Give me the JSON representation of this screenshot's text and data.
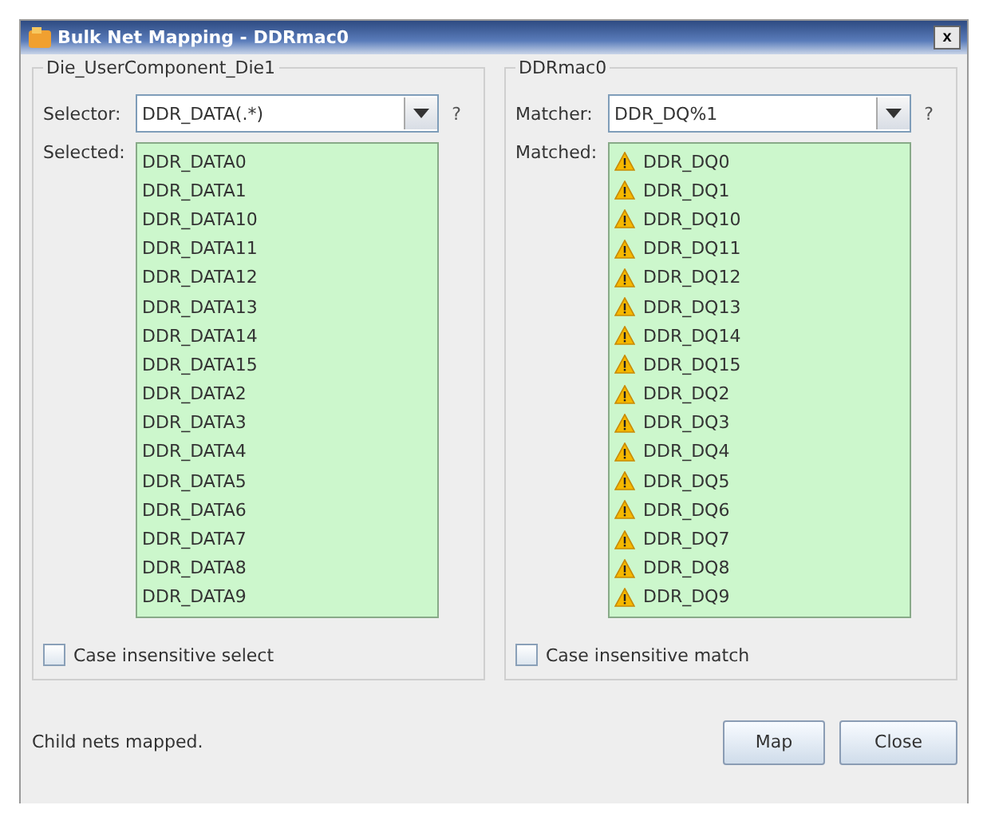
{
  "window": {
    "title": "Bulk Net Mapping - DDRmac0",
    "close": "x"
  },
  "panels": [
    {
      "title": "Die_UserComponent_Die1",
      "field_label": "Selector:",
      "field_value": "DDR_DATA(.*)",
      "help": "?",
      "list_label": "Selected:",
      "items": [
        {
          "label": "DDR_DATA0",
          "warning": false
        },
        {
          "label": "DDR_DATA1",
          "warning": false
        },
        {
          "label": "DDR_DATA10",
          "warning": false
        },
        {
          "label": "DDR_DATA11",
          "warning": false
        },
        {
          "label": "DDR_DATA12",
          "warning": false
        },
        {
          "label": "DDR_DATA13",
          "warning": false
        },
        {
          "label": "DDR_DATA14",
          "warning": false
        },
        {
          "label": "DDR_DATA15",
          "warning": false
        },
        {
          "label": "DDR_DATA2",
          "warning": false
        },
        {
          "label": "DDR_DATA3",
          "warning": false
        },
        {
          "label": "DDR_DATA4",
          "warning": false
        },
        {
          "label": "DDR_DATA5",
          "warning": false
        },
        {
          "label": "DDR_DATA6",
          "warning": false
        },
        {
          "label": "DDR_DATA7",
          "warning": false
        },
        {
          "label": "DDR_DATA8",
          "warning": false
        },
        {
          "label": "DDR_DATA9",
          "warning": false
        }
      ],
      "checkbox": {
        "label": "Case insensitive select",
        "checked": false
      }
    },
    {
      "title": "DDRmac0",
      "field_label": "Matcher:",
      "field_value": "DDR_DQ%1",
      "help": "?",
      "list_label": "Matched:",
      "items": [
        {
          "label": "DDR_DQ0",
          "warning": true
        },
        {
          "label": "DDR_DQ1",
          "warning": true
        },
        {
          "label": "DDR_DQ10",
          "warning": true
        },
        {
          "label": "DDR_DQ11",
          "warning": true
        },
        {
          "label": "DDR_DQ12",
          "warning": true
        },
        {
          "label": "DDR_DQ13",
          "warning": true
        },
        {
          "label": "DDR_DQ14",
          "warning": true
        },
        {
          "label": "DDR_DQ15",
          "warning": true
        },
        {
          "label": "DDR_DQ2",
          "warning": true
        },
        {
          "label": "DDR_DQ3",
          "warning": true
        },
        {
          "label": "DDR_DQ4",
          "warning": true
        },
        {
          "label": "DDR_DQ5",
          "warning": true
        },
        {
          "label": "DDR_DQ6",
          "warning": true
        },
        {
          "label": "DDR_DQ7",
          "warning": true
        },
        {
          "label": "DDR_DQ8",
          "warning": true
        },
        {
          "label": "DDR_DQ9",
          "warning": true
        }
      ],
      "checkbox": {
        "label": "Case insensitive match",
        "checked": false
      }
    }
  ],
  "status": "Child nets mapped.",
  "buttons": [
    "Map",
    "Close"
  ]
}
